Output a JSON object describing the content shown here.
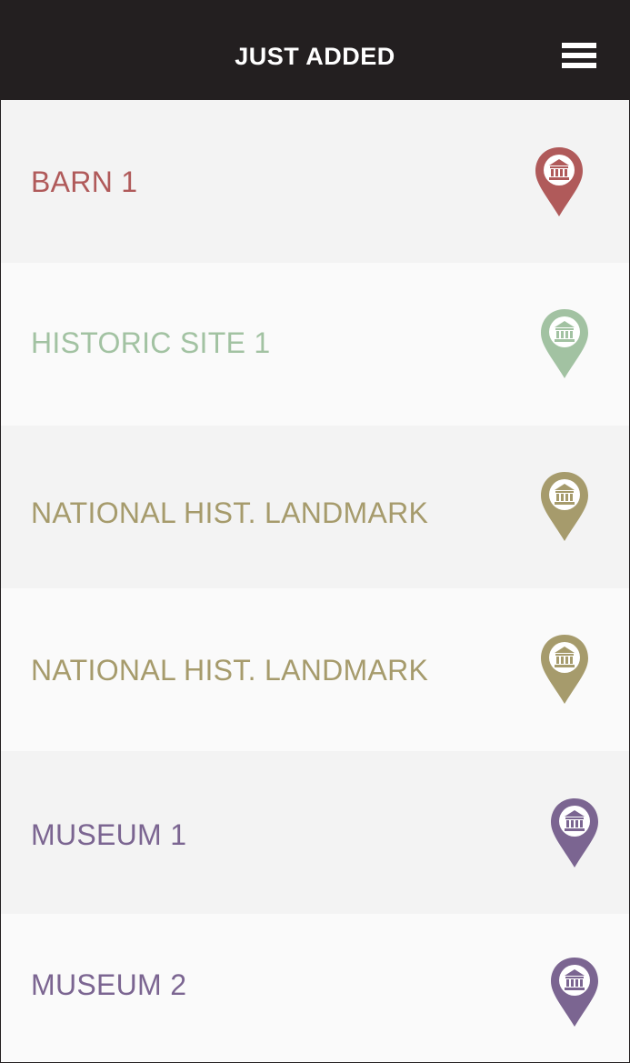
{
  "header": {
    "title": "JUST ADDED",
    "menu_icon": "hamburger-menu-icon"
  },
  "items": [
    {
      "label": "BARN 1",
      "color": "#b05a5a",
      "icon": "landmark-pin-icon"
    },
    {
      "label": "HISTORIC SITE 1",
      "color": "#a2c2a2",
      "icon": "landmark-pin-icon"
    },
    {
      "label": "NATIONAL HIST. LANDMARK",
      "color": "#a69b6c",
      "icon": "landmark-pin-icon"
    },
    {
      "label": "NATIONAL HIST. LANDMARK",
      "color": "#a69b6c",
      "icon": "landmark-pin-icon"
    },
    {
      "label": "MUSEUM 1",
      "color": "#7b6591",
      "icon": "landmark-pin-icon"
    },
    {
      "label": "MUSEUM 2",
      "color": "#7b6591",
      "icon": "landmark-pin-icon"
    }
  ]
}
